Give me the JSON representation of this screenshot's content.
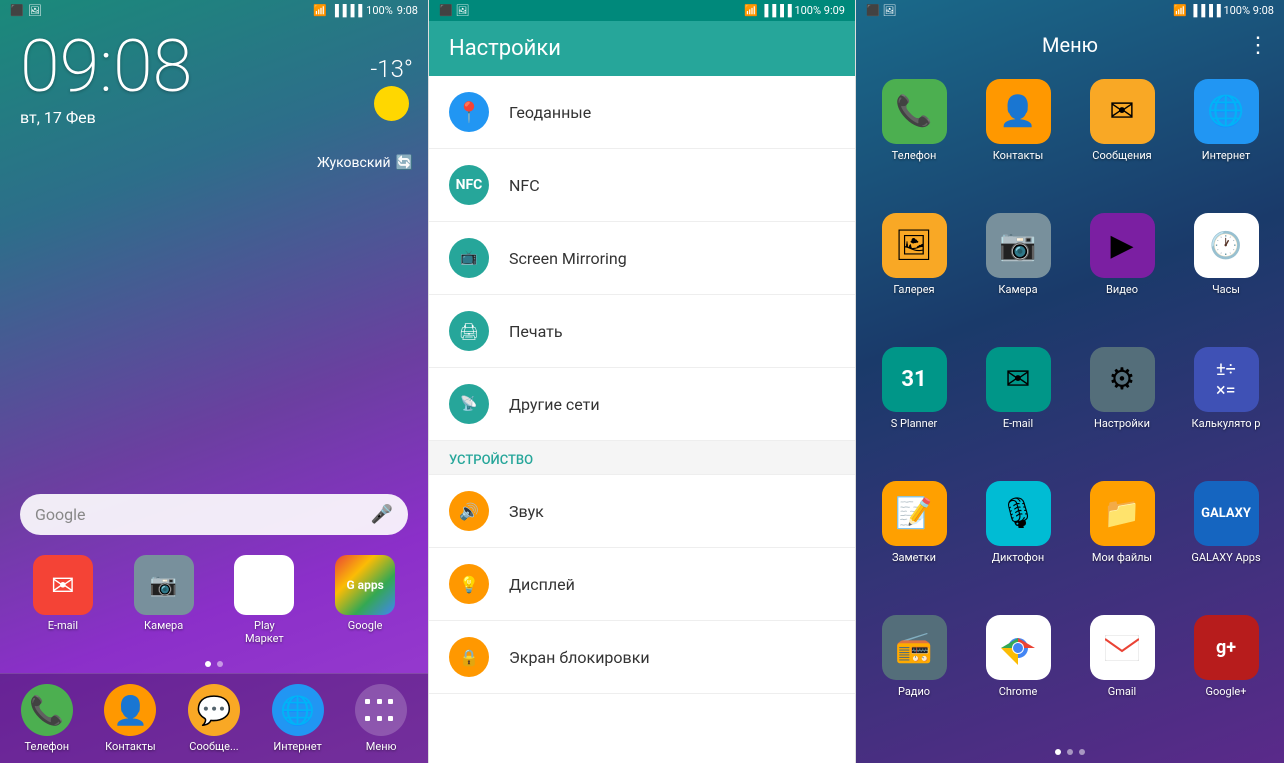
{
  "panel1": {
    "statusBar": {
      "leftIcons": "📶",
      "time": "9:08",
      "battery": "100%"
    },
    "clock": "09:08",
    "date": "вт, 17 Фев",
    "weather": {
      "temp": "-13°",
      "location": "Жуковский"
    },
    "search": {
      "placeholder": "Google",
      "micLabel": "🎤"
    },
    "apps": [
      {
        "label": "E-mail",
        "bg": "bg-red",
        "icon": "✉"
      },
      {
        "label": "Камера",
        "bg": "bg-gray",
        "icon": "📷"
      },
      {
        "label": "Play Маркет",
        "bg": "bg-white-circle",
        "icon": "▶"
      },
      {
        "label": "Google",
        "bg": "bg-red",
        "icon": "G"
      }
    ],
    "dock": [
      {
        "label": "Телефон",
        "bg": "bg-green",
        "icon": "📞"
      },
      {
        "label": "Контакты",
        "bg": "bg-orange",
        "icon": "👤"
      },
      {
        "label": "Сообще...",
        "bg": "bg-yellow",
        "icon": "💬"
      },
      {
        "label": "Интернет",
        "bg": "bg-blue",
        "icon": "🌐"
      },
      {
        "label": "Меню",
        "bg": "bg-dark-gray",
        "icon": "⋮⋮⋮"
      }
    ]
  },
  "panel2": {
    "statusBar": {
      "time": "9:09",
      "battery": "100%"
    },
    "title": "Настройки",
    "items": [
      {
        "label": "Геоданные",
        "iconType": "icon-blue",
        "icon": "📍"
      },
      {
        "label": "NFC",
        "iconType": "icon-teal",
        "icon": "📲"
      },
      {
        "label": "Screen Mirroring",
        "iconType": "icon-teal",
        "icon": "📺"
      },
      {
        "label": "Печать",
        "iconType": "icon-teal",
        "icon": "🖨"
      },
      {
        "label": "Другие сети",
        "iconType": "icon-teal",
        "icon": "📡"
      }
    ],
    "sectionHeader": "УСТРОЙСТВО",
    "deviceItems": [
      {
        "label": "Звук",
        "iconType": "icon-orange",
        "icon": "🔊"
      },
      {
        "label": "Дисплей",
        "iconType": "icon-orange",
        "icon": "💡"
      },
      {
        "label": "Экран блокировки",
        "iconType": "icon-orange",
        "icon": "🔒"
      }
    ]
  },
  "panel3": {
    "statusBar": {
      "time": "9:08",
      "battery": "100%"
    },
    "title": "Меню",
    "menuIcon": "⋮",
    "apps": [
      {
        "label": "Телефон",
        "bg": "bg-green",
        "icon": "📞"
      },
      {
        "label": "Контакты",
        "bg": "bg-orange",
        "icon": "👤"
      },
      {
        "label": "Сообщения",
        "bg": "bg-yellow-dark",
        "icon": "✉"
      },
      {
        "label": "Интернет",
        "bg": "bg-blue",
        "icon": "🌐"
      },
      {
        "label": "Галерея",
        "bg": "bg-yellow-dark",
        "icon": "🖼"
      },
      {
        "label": "Камера",
        "bg": "bg-gray",
        "icon": "📷"
      },
      {
        "label": "Видео",
        "bg": "bg-purple",
        "icon": "▶"
      },
      {
        "label": "Часы",
        "bg": "bg-white-circle",
        "icon": "🕐"
      },
      {
        "label": "S Planner",
        "bg": "bg-teal",
        "icon": "31"
      },
      {
        "label": "E-mail",
        "bg": "bg-teal",
        "icon": "✉"
      },
      {
        "label": "Настройки",
        "bg": "bg-dark-gray",
        "icon": "⚙"
      },
      {
        "label": "Калькулятор",
        "bg": "bg-indigo",
        "icon": "🔢"
      },
      {
        "label": "Заметки",
        "bg": "bg-amber",
        "icon": "📝"
      },
      {
        "label": "Диктофон",
        "bg": "bg-cyan",
        "icon": "🎙"
      },
      {
        "label": "Мои файлы",
        "bg": "bg-amber",
        "icon": "📁"
      },
      {
        "label": "GALAXY Apps",
        "bg": "bg-dark-blue",
        "icon": "G"
      },
      {
        "label": "Радио",
        "bg": "bg-dark-gray",
        "icon": "📻"
      },
      {
        "label": "Chrome",
        "bg": "bg-white-circle",
        "icon": "🌐"
      },
      {
        "label": "Gmail",
        "bg": "bg-white-circle",
        "icon": "✉"
      },
      {
        "label": "Google+",
        "bg": "bg-dark-red",
        "icon": "g+"
      }
    ],
    "dots": [
      "active",
      "inactive",
      "inactive"
    ]
  }
}
